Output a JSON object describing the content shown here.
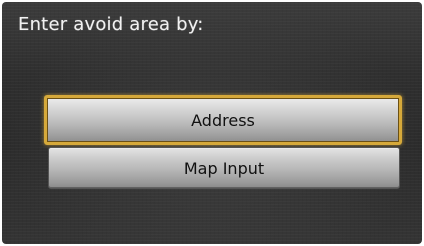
{
  "screen": {
    "prompt": "Enter avoid area by:"
  },
  "options": {
    "address_label": "Address",
    "map_input_label": "Map Input"
  },
  "colors": {
    "selection_border": "#d6a93a",
    "background": "#2f2f2f"
  }
}
